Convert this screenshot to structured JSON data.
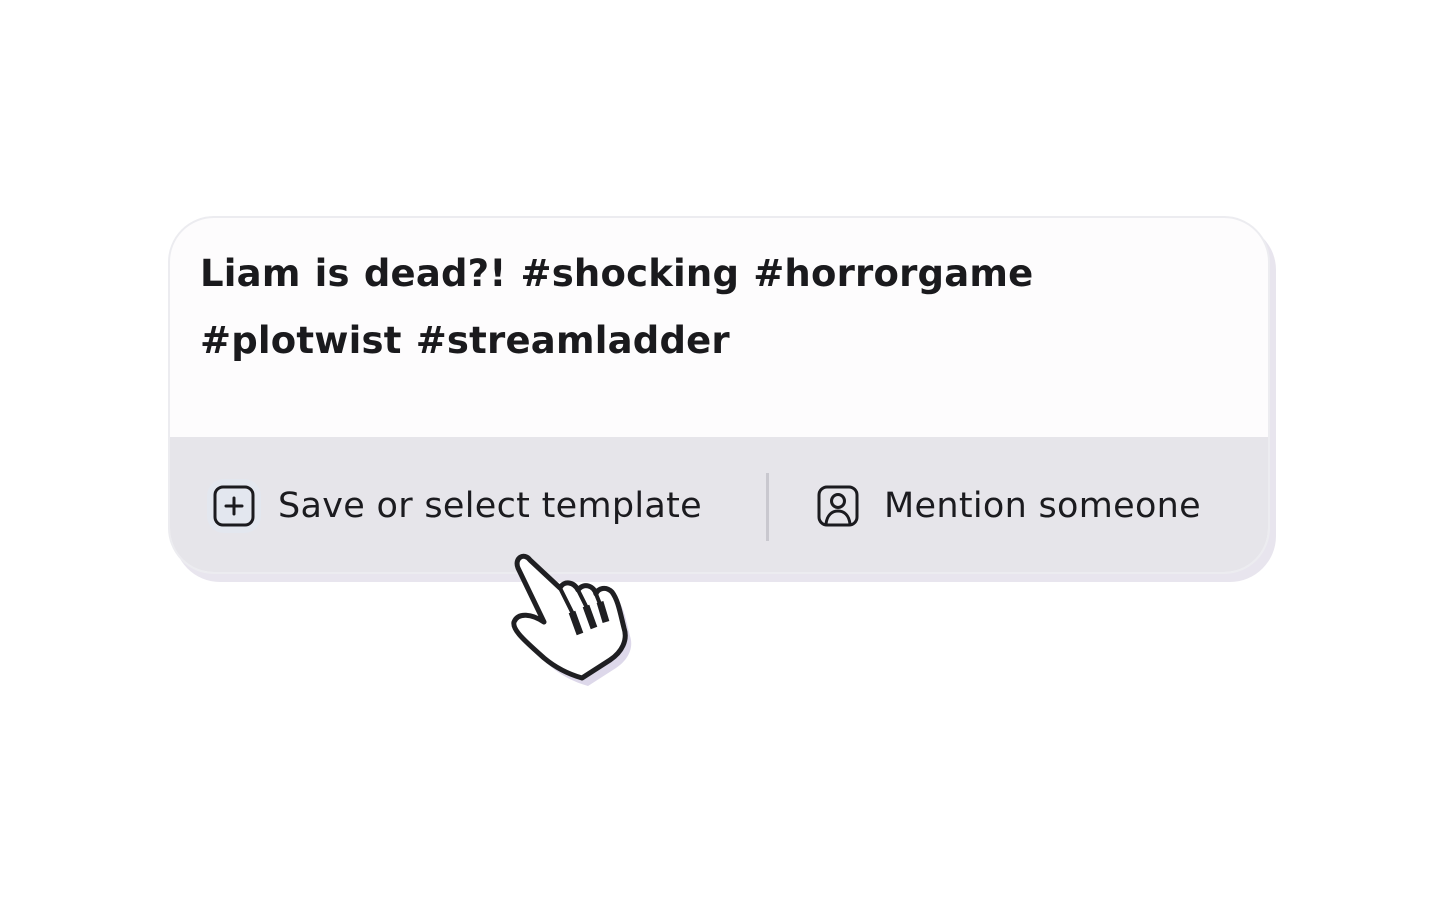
{
  "caption": {
    "text": "Liam is dead?! #shocking #horrorgame #plotwist #streamladder"
  },
  "toolbar": {
    "template_label": "Save or select template",
    "template_icon": "plus-square-icon",
    "mention_label": "Mention someone",
    "mention_icon": "user-square-icon"
  },
  "colors": {
    "card_background": "#fdfcfd",
    "toolbar_background": "#e6e5ea",
    "text": "#1a1a1d",
    "divider": "#c9c8cf",
    "shadow": "#e8e5ee"
  },
  "cursor": {
    "icon": "hand-pointer-cursor-icon"
  }
}
